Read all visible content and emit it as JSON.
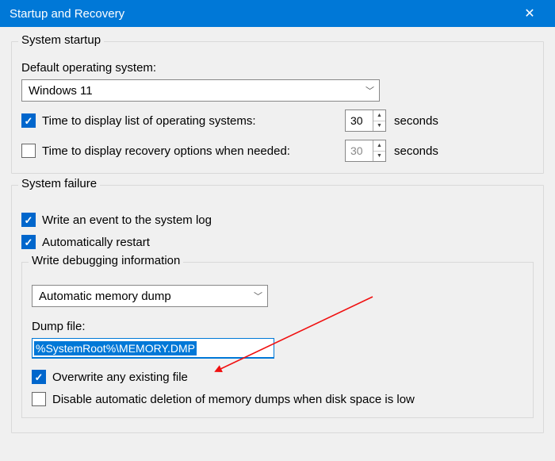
{
  "window": {
    "title": "Startup and Recovery"
  },
  "system_startup": {
    "group_title": "System startup",
    "default_os_label": "Default operating system:",
    "default_os_value": "Windows 11",
    "time_os_label": "Time to display list of operating systems:",
    "time_os_value": "30",
    "time_recovery_label": "Time to display recovery options when needed:",
    "time_recovery_value": "30",
    "seconds_unit": "seconds"
  },
  "system_failure": {
    "group_title": "System failure",
    "write_event_label": "Write an event to the system log",
    "auto_restart_label": "Automatically restart",
    "debug_group_title": "Write debugging information",
    "dump_type": "Automatic memory dump",
    "dump_file_label": "Dump file:",
    "dump_file_value": "%SystemRoot%\\MEMORY.DMP",
    "overwrite_label": "Overwrite any existing file",
    "disable_delete_label": "Disable automatic deletion of memory dumps when disk space is low"
  }
}
